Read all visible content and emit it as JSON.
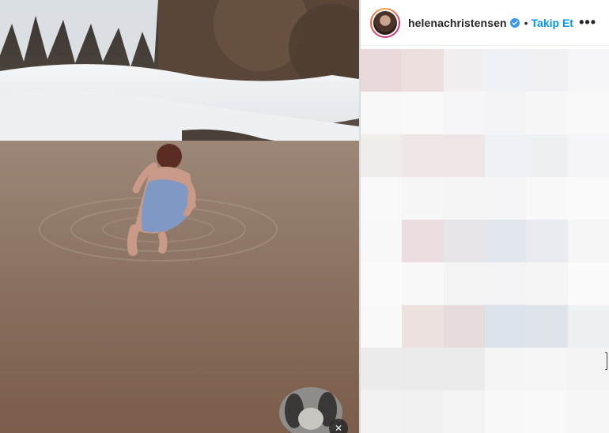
{
  "post": {
    "author": {
      "username": "helenachristensen",
      "verified": true
    },
    "follow_label": "Takip Et",
    "separator": "•",
    "more_icon": "more-horizontal-icon"
  },
  "colors": {
    "follow_blue": "#0095f6",
    "verified_blue": "#3897f0",
    "text_dark": "#262626"
  },
  "blurred_comments": [
    [
      "#ead9db",
      "#eedfdf",
      "#f3eef0",
      "#eef1f5",
      "#f1f1f5",
      "#f6f6f8"
    ],
    [
      "#f8f8f9",
      "#f9f9fa",
      "#f6f6f8",
      "#f4f4f6",
      "#f7f7f8",
      "#f9f9f9"
    ],
    [
      "#f0ecec",
      "#efe7e6",
      "#eee6e6",
      "#eef1f6",
      "#eef0f4",
      "#f5f5f7"
    ],
    [
      "#f9f9fa",
      "#f7f7f8",
      "#f5f5f6",
      "#f5f5f7",
      "#f8f8f8",
      "#fafafa"
    ],
    [
      "#f8f8f8",
      "#ecdde0",
      "#e8e5e8",
      "#e2e7ee",
      "#e9ebf0",
      "#f7f7f8"
    ],
    [
      "#fafafa",
      "#f8f8f8",
      "#f4f4f5",
      "#f3f3f5",
      "#f5f5f6",
      "#fbfbfb"
    ],
    [
      "#f9f9f9",
      "#ece3e0",
      "#e6dcdc",
      "#dde3ea",
      "#dfe3ea",
      "#eef0f3"
    ],
    [
      "#ececed",
      "#ebebec",
      "#ecebec",
      "#f5f5f6",
      "#f6f6f7",
      "#f4f4f5"
    ],
    [
      "#f2f2f3",
      "#f1f1f2",
      "#f3f3f4",
      "#f8f8f9",
      "#f9f9fa",
      "#f7f7f8"
    ]
  ]
}
